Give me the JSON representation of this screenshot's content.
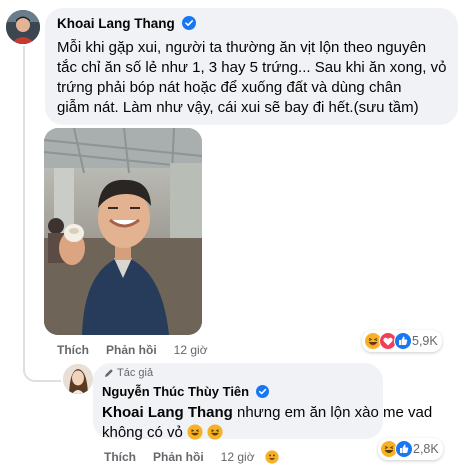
{
  "main_comment": {
    "author": "Khoai Lang Thang",
    "text_lines": [
      "Mỗi khi gặp xui, người ta thường ăn vịt lộn theo nguyên",
      "tắc chỉ ăn số lẻ như 1, 3 hay 5 trứng... Sau khi ăn xong, vỏ",
      "trứng phải bóp nát hoặc để xuống đất và dùng chân",
      "giẫm nát. Làm như vậy, cái xui sẽ bay đi hết.(sưu tầm)"
    ],
    "actions": {
      "like": "Thích",
      "reply": "Phản hồi",
      "time": "12 giờ"
    },
    "reaction_count": "5,9K",
    "reaction_icons": [
      "haha-icon",
      "love-icon",
      "like-icon"
    ]
  },
  "reply_comment": {
    "role": "Tác giả",
    "author": "Nguyễn Thúc Thùy Tiên",
    "mention": "Khoai Lang Thang",
    "text_line1_rest": " nhưng em ăn lộn xào me vad",
    "text_line2": "không có vỏ ",
    "actions": {
      "like": "Thích",
      "reply": "Phản hồi",
      "time": "12 giờ"
    },
    "reaction_count": "2,8K",
    "reaction_icons": [
      "haha-icon",
      "like-icon"
    ]
  },
  "colors": {
    "bubble": "#f0f2f5",
    "verified": "#1877f2",
    "secondary_text": "#65676b",
    "like_blue": "#1877f2",
    "love_red": "#f33e58",
    "haha_yellow": "#f7b125"
  }
}
